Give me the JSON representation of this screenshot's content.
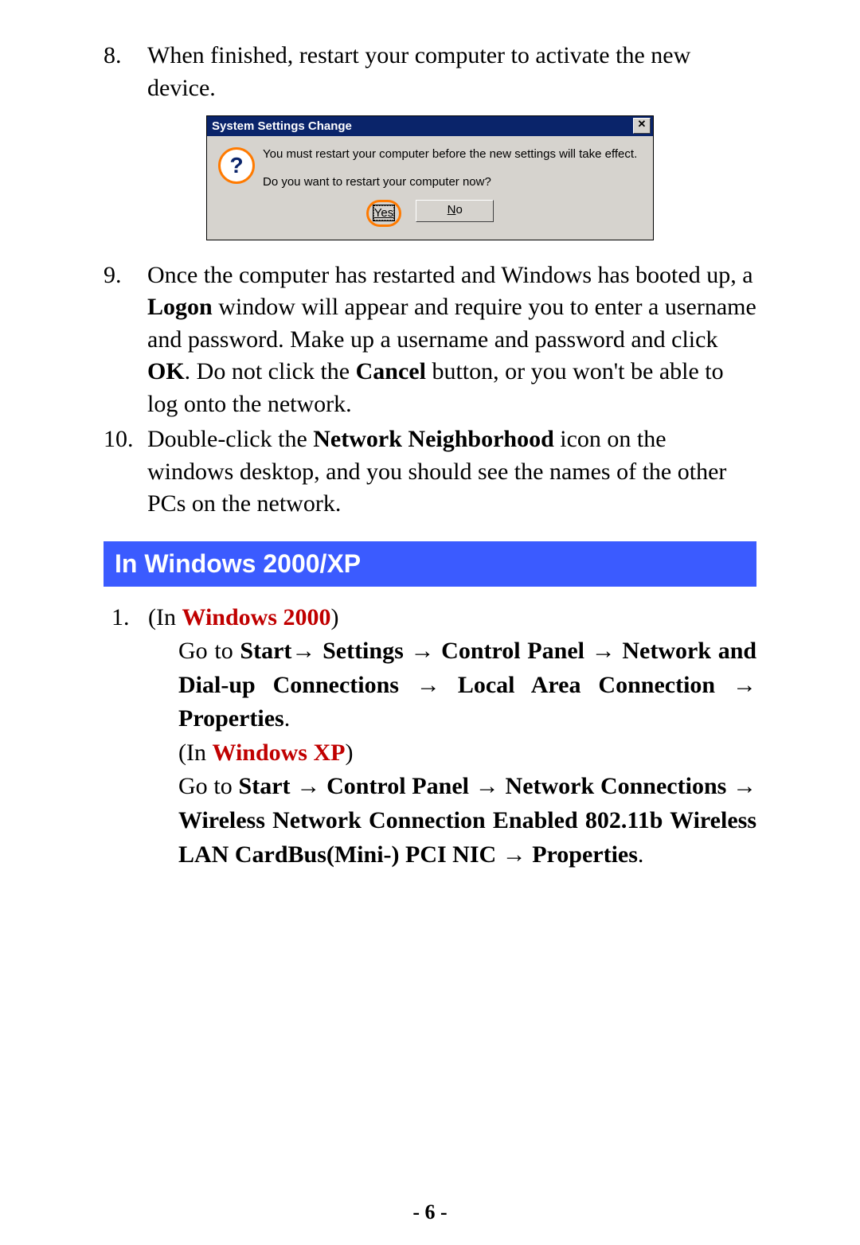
{
  "list1": {
    "items": [
      {
        "num": "8.",
        "text": "When finished, restart your computer to activate the new device."
      },
      {
        "num": "9.",
        "pre": "Once the computer has restarted and Windows has booted up, a ",
        "b1": "Logon",
        "mid1": " window will appear and require you to enter a username and password. Make up a username and password and click ",
        "b2": "OK",
        "mid2": ".   Do not click the ",
        "b3": "Cancel",
        "post": " button, or you won't be able to log onto the network."
      },
      {
        "num": "10.",
        "pre": "Double-click the ",
        "b1": "Network Neighborhood",
        "post": " icon on the windows desktop, and you should see the names of the other PCs on the network."
      }
    ]
  },
  "dialog": {
    "title": "System Settings Change",
    "close": "✕",
    "icon_glyph": "?",
    "line1": "You must restart your computer before the new settings will take effect.",
    "line2": "Do you want to restart your computer now?",
    "yes_label": "Yes",
    "no_label": "No",
    "no_underline": "N",
    "no_rest": "o"
  },
  "section_heading": "In Windows 2000/XP",
  "list2": {
    "num": "1.",
    "in_label": "(In ",
    "w2000": "Windows 2000",
    "wxp": "Windows XP",
    "close_paren": ")",
    "goto": "Go to ",
    "start": "Start",
    "settings": "Settings",
    "cpanel": "Control Panel",
    "ndu": "Network and Dial-up Connections",
    "lac": "Local Area Connection",
    "props": "Properties",
    "netconn": "Network Connections",
    "wnc": "Wireless Network Connection Enabled 802.11b Wireless LAN CardBus(Mini-) PCI NIC",
    "arrow": "→",
    "period": "."
  },
  "page_number": "- 6 -"
}
